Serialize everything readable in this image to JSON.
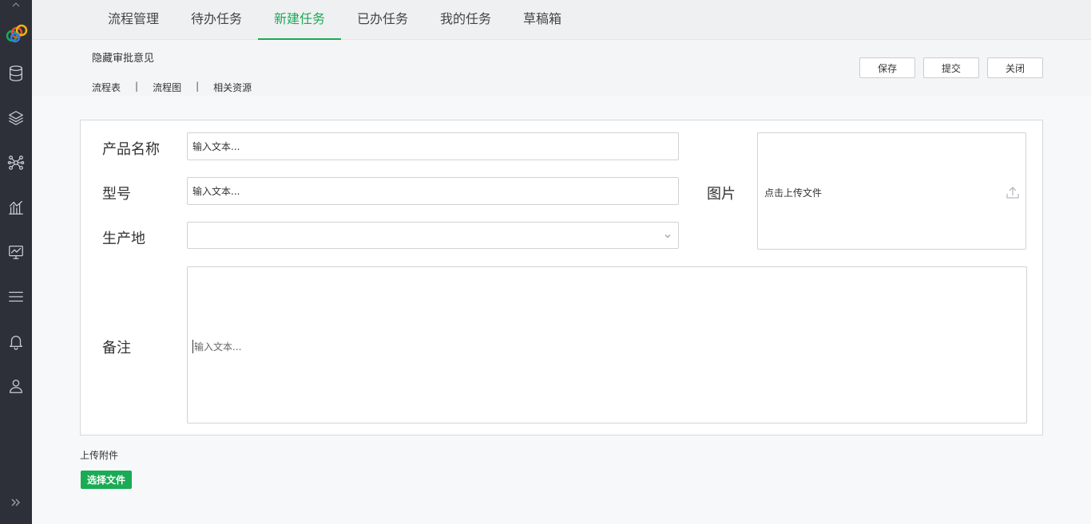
{
  "nav": {
    "tabs": [
      {
        "label": "流程管理"
      },
      {
        "label": "待办任务"
      },
      {
        "label": "新建任务"
      },
      {
        "label": "已办任务"
      },
      {
        "label": "我的任务"
      },
      {
        "label": "草稿箱"
      }
    ],
    "active_tab": "新建任务",
    "accent_color": "#1aab55"
  },
  "subheader": {
    "hide_opinion": "隐藏审批意见",
    "links": [
      "流程表",
      "流程图",
      "相关资源"
    ],
    "separator": "|",
    "buttons": {
      "save": "保存",
      "submit": "提交",
      "close": "关闭"
    }
  },
  "form": {
    "product_name": {
      "label": "产品名称",
      "value": "输入文本..."
    },
    "model": {
      "label": "型号",
      "value": "输入文本..."
    },
    "origin": {
      "label": "生产地",
      "value": ""
    },
    "image": {
      "label": "图片",
      "upload_text": "点击上传文件"
    },
    "remarks": {
      "label": "备注",
      "placeholder": "输入文本..."
    }
  },
  "attachments": {
    "label": "上传附件",
    "choose_button": "选择文件"
  },
  "sidebar": {
    "icons": [
      "database-icon",
      "layers-icon",
      "network-icon",
      "chart-icon",
      "monitor-icon",
      "menu-icon",
      "bell-icon",
      "user-icon"
    ]
  }
}
